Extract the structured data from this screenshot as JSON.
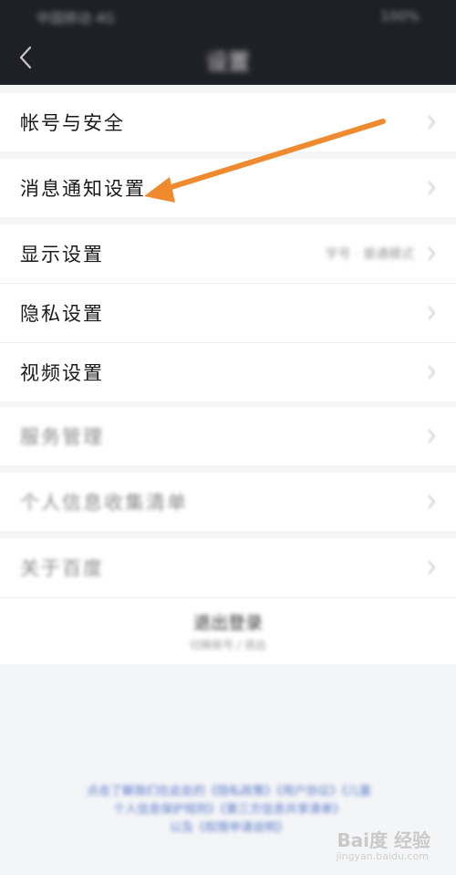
{
  "status": {
    "left": "中国移动 4G",
    "right": "100%"
  },
  "header": {
    "title": "设置",
    "back_icon": "chevron-left-icon"
  },
  "groups": [
    {
      "items": [
        {
          "label": "帐号与安全"
        }
      ]
    },
    {
      "items": [
        {
          "label": "消息通知设置"
        }
      ]
    },
    {
      "items": [
        {
          "label": "显示设置",
          "value": "字号 · 普通模式"
        },
        {
          "label": "隐私设置"
        },
        {
          "label": "视频设置"
        }
      ]
    },
    {
      "items": [
        {
          "label": "服务管理"
        }
      ]
    },
    {
      "items": [
        {
          "label": "个人信息收集清单"
        }
      ]
    },
    {
      "items": [
        {
          "label": "关于百度"
        }
      ]
    }
  ],
  "logout": {
    "label": "退出登录",
    "sub": "切换账号 / 退出"
  },
  "footer": {
    "line1": "点击了解我们在此处的《隐私政策》《用户协议》《儿童",
    "line2": "个人信息保护规则》《第三方信息共享清单》",
    "line3": "以及《权限申请说明》"
  },
  "watermark": {
    "brand": "Bai度 经验",
    "url": "jingyan.baidu.com"
  },
  "colors": {
    "header_bg": "#1f1f27",
    "page_bg": "#f4f5f7",
    "arrow": "#f08a2e"
  }
}
